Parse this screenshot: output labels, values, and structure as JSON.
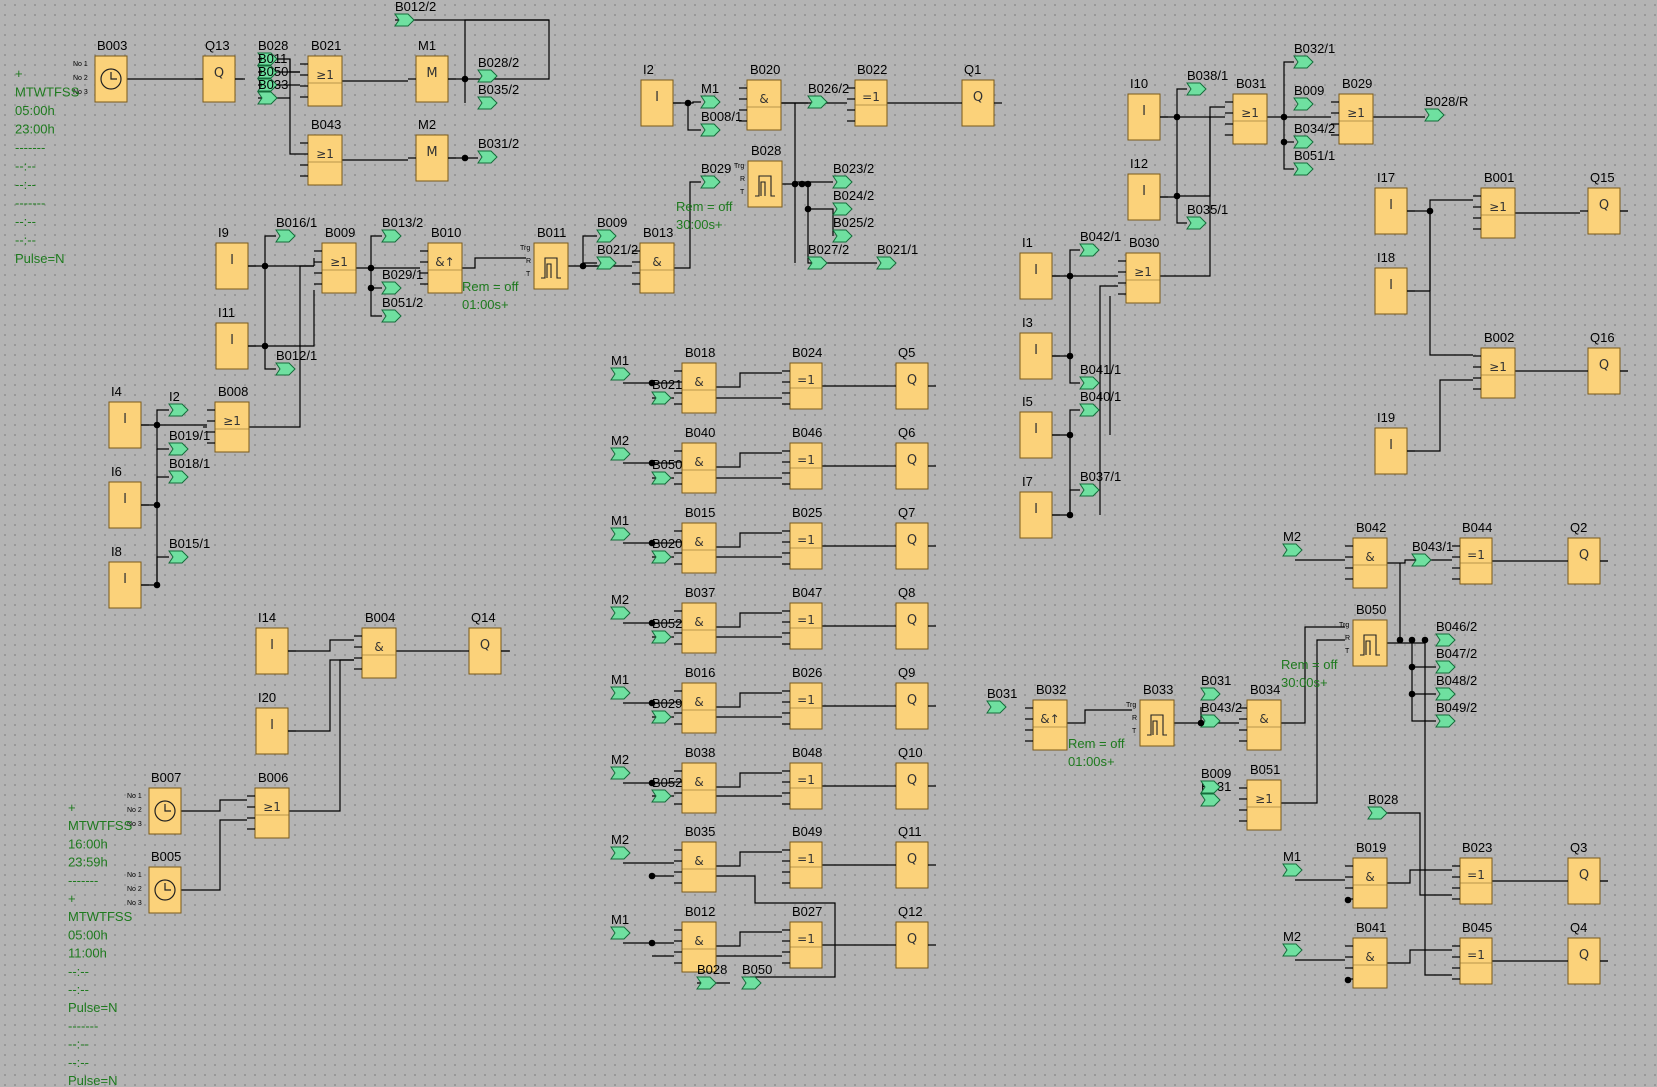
{
  "diagram": {
    "blocks": [
      {
        "id": "B003",
        "label": "B003",
        "kind": "clock"
      },
      {
        "id": "Q13",
        "label": "Q13",
        "kind": "Q"
      },
      {
        "id": "B021",
        "label": "B021",
        "kind": "or"
      },
      {
        "id": "M1a",
        "label": "M1",
        "kind": "M"
      },
      {
        "id": "B043",
        "label": "B043",
        "kind": "or"
      },
      {
        "id": "M2a",
        "label": "M2",
        "kind": "M"
      },
      {
        "id": "I9",
        "label": "I9",
        "kind": "I"
      },
      {
        "id": "B009",
        "label": "B009",
        "kind": "or"
      },
      {
        "id": "B010",
        "label": "B010",
        "kind": "andedge"
      },
      {
        "id": "B011",
        "label": "B011",
        "kind": "pulse"
      },
      {
        "id": "B013",
        "label": "B013",
        "kind": "and"
      },
      {
        "id": "I11",
        "label": "I11",
        "kind": "I"
      },
      {
        "id": "I4a",
        "label": "I4",
        "kind": "I"
      },
      {
        "id": "B008",
        "label": "B008",
        "kind": "or"
      },
      {
        "id": "I6a",
        "label": "I6",
        "kind": "I"
      },
      {
        "id": "I8a",
        "label": "I8",
        "kind": "I"
      },
      {
        "id": "I2",
        "label": "I2",
        "kind": "I"
      },
      {
        "id": "B020",
        "label": "B020",
        "kind": "and"
      },
      {
        "id": "B022",
        "label": "B022",
        "kind": "xor"
      },
      {
        "id": "Q1",
        "label": "Q1",
        "kind": "Q"
      },
      {
        "id": "B028",
        "label": "B028",
        "kind": "pulse"
      },
      {
        "id": "I14",
        "label": "I14",
        "kind": "I"
      },
      {
        "id": "B004",
        "label": "B004",
        "kind": "and"
      },
      {
        "id": "Q14",
        "label": "Q14",
        "kind": "Q"
      },
      {
        "id": "I20",
        "label": "I20",
        "kind": "I"
      },
      {
        "id": "B007",
        "label": "B007",
        "kind": "clock"
      },
      {
        "id": "B006",
        "label": "B006",
        "kind": "or"
      },
      {
        "id": "B005",
        "label": "B005",
        "kind": "clock"
      },
      {
        "id": "B018",
        "label": "B018",
        "kind": "and"
      },
      {
        "id": "B024",
        "label": "B024",
        "kind": "xor"
      },
      {
        "id": "Q5",
        "label": "Q5",
        "kind": "Q"
      },
      {
        "id": "B040",
        "label": "B040",
        "kind": "and"
      },
      {
        "id": "B046",
        "label": "B046",
        "kind": "xor"
      },
      {
        "id": "Q6",
        "label": "Q6",
        "kind": "Q"
      },
      {
        "id": "B015",
        "label": "B015",
        "kind": "and"
      },
      {
        "id": "B025",
        "label": "B025",
        "kind": "xor"
      },
      {
        "id": "Q7",
        "label": "Q7",
        "kind": "Q"
      },
      {
        "id": "B037",
        "label": "B037",
        "kind": "and"
      },
      {
        "id": "B047",
        "label": "B047",
        "kind": "xor"
      },
      {
        "id": "Q8",
        "label": "Q8",
        "kind": "Q"
      },
      {
        "id": "B016",
        "label": "B016",
        "kind": "and"
      },
      {
        "id": "B026",
        "label": "B026",
        "kind": "xor"
      },
      {
        "id": "Q9",
        "label": "Q9",
        "kind": "Q"
      },
      {
        "id": "B038",
        "label": "B038",
        "kind": "and"
      },
      {
        "id": "B048",
        "label": "B048",
        "kind": "xor"
      },
      {
        "id": "Q10",
        "label": "Q10",
        "kind": "Q"
      },
      {
        "id": "B035",
        "label": "B035",
        "kind": "and"
      },
      {
        "id": "B049",
        "label": "B049",
        "kind": "xor"
      },
      {
        "id": "Q11",
        "label": "Q11",
        "kind": "Q"
      },
      {
        "id": "B012",
        "label": "B012",
        "kind": "and"
      },
      {
        "id": "B027",
        "label": "B027",
        "kind": "xor"
      },
      {
        "id": "Q12",
        "label": "Q12",
        "kind": "Q"
      },
      {
        "id": "I10",
        "label": "I10",
        "kind": "I"
      },
      {
        "id": "B031",
        "label": "B031",
        "kind": "or"
      },
      {
        "id": "B029",
        "label": "B029",
        "kind": "or"
      },
      {
        "id": "I12",
        "label": "I12",
        "kind": "I"
      },
      {
        "id": "I17",
        "label": "I17",
        "kind": "I"
      },
      {
        "id": "B001",
        "label": "B001",
        "kind": "or"
      },
      {
        "id": "Q15",
        "label": "Q15",
        "kind": "Q"
      },
      {
        "id": "I18",
        "label": "I18",
        "kind": "I"
      },
      {
        "id": "I1",
        "label": "I1",
        "kind": "I"
      },
      {
        "id": "B030",
        "label": "B030",
        "kind": "or"
      },
      {
        "id": "I3",
        "label": "I3",
        "kind": "I"
      },
      {
        "id": "B002",
        "label": "B002",
        "kind": "or"
      },
      {
        "id": "Q16",
        "label": "Q16",
        "kind": "Q"
      },
      {
        "id": "I5",
        "label": "I5",
        "kind": "I"
      },
      {
        "id": "I19",
        "label": "I19",
        "kind": "I"
      },
      {
        "id": "I7",
        "label": "I7",
        "kind": "I"
      },
      {
        "id": "B042",
        "label": "B042",
        "kind": "and"
      },
      {
        "id": "B044",
        "label": "B044",
        "kind": "xor"
      },
      {
        "id": "Q2",
        "label": "Q2",
        "kind": "Q"
      },
      {
        "id": "B050",
        "label": "B050",
        "kind": "pulse"
      },
      {
        "id": "B032",
        "label": "B032",
        "kind": "andedge"
      },
      {
        "id": "B033",
        "label": "B033",
        "kind": "pulse"
      },
      {
        "id": "B034",
        "label": "B034",
        "kind": "and"
      },
      {
        "id": "B051",
        "label": "B051",
        "kind": "or"
      },
      {
        "id": "B019",
        "label": "B019",
        "kind": "and"
      },
      {
        "id": "B023",
        "label": "B023",
        "kind": "xor"
      },
      {
        "id": "Q3",
        "label": "Q3",
        "kind": "Q"
      },
      {
        "id": "B041",
        "label": "B041",
        "kind": "and"
      },
      {
        "id": "B045",
        "label": "B045",
        "kind": "xor"
      },
      {
        "id": "Q4",
        "label": "Q4",
        "kind": "Q"
      }
    ],
    "symbols": {
      "I": "I",
      "Q": "Q",
      "M": "M",
      "and": "&",
      "or": "≥1",
      "xor": "=1",
      "andedge": "&↑"
    },
    "flags": [
      "B012/2",
      "B028",
      "B011",
      "B050",
      "B033",
      "B028/2",
      "B035/2",
      "B031/2",
      "B016/1",
      "B013/2",
      "B029/1",
      "B051/2",
      "B012/1",
      "B009",
      "B021/2",
      "I2",
      "B019/1",
      "B018/1",
      "B015/1",
      "M1",
      "B008/1",
      "B026/2",
      "B029",
      "B023/2",
      "B024/2",
      "B025/2",
      "B027/2",
      "B021/1",
      "M1",
      "B021",
      "M2",
      "B050",
      "M1",
      "B020",
      "M2",
      "B052",
      "M1",
      "B029",
      "M2",
      "B052",
      "M2",
      "M1",
      "B028",
      "B050",
      "B038/1",
      "B032/1",
      "B009",
      "B028/R",
      "B034/2",
      "B051/1",
      "B035/1",
      "B042/1",
      "B041/1",
      "B040/1",
      "B037/1",
      "M2",
      "B043/1",
      "B046/2",
      "B047/2",
      "B048/2",
      "B049/2",
      "B031",
      "B031",
      "B043/2",
      "B031",
      "B009",
      "B028",
      "M1",
      "M2"
    ],
    "pin_labels": [
      "No 1",
      "No 2",
      "No 3",
      "Trg",
      "R",
      "T"
    ],
    "notes": [
      {
        "id": "timer1",
        "lines": [
          "+",
          "MTWTFSS",
          "05:00h",
          "23:00h",
          "-------",
          "--:--",
          "--:--",
          "-------",
          "--:--",
          "--:--",
          "Pulse=N"
        ]
      },
      {
        "id": "rem_b028",
        "lines": [
          "Rem = off",
          "30:00s+"
        ]
      },
      {
        "id": "rem_b011",
        "lines": [
          "Rem = off",
          "01:00s+"
        ]
      },
      {
        "id": "timer2",
        "lines": [
          "+",
          "MTWTFSS",
          "16:00h",
          "23:59h",
          "-------",
          "+",
          "MTWTFSS",
          "05:00h",
          "11:00h",
          "--:--",
          "--:--",
          "Pulse=N",
          "-------",
          "--:--",
          "--:--",
          "Pulse=N"
        ]
      },
      {
        "id": "rem_b050",
        "lines": [
          "Rem = off",
          "30:00s+"
        ]
      },
      {
        "id": "rem_b033",
        "lines": [
          "Rem = off",
          "01:00s+"
        ]
      }
    ]
  }
}
